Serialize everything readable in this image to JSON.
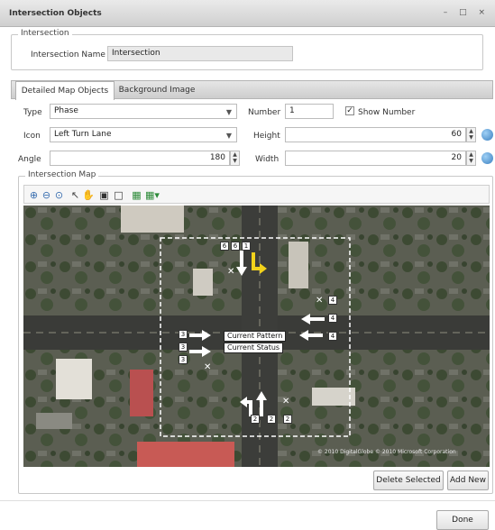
{
  "window": {
    "title": "Intersection Objects",
    "controls": "– □ ×"
  },
  "intersection_group": {
    "legend": "Intersection",
    "name_label": "Intersection Name",
    "name_value": "Intersection"
  },
  "tabs": [
    {
      "label": "Detailed Map Objects",
      "active": true
    },
    {
      "label": "Background Image",
      "active": false
    }
  ],
  "form": {
    "type_label": "Type",
    "type_value": "Phase",
    "number_label": "Number",
    "number_value": "1",
    "show_number_label": "Show Number",
    "show_number_checked": true,
    "icon_label": "Icon",
    "icon_value": "Left Turn Lane",
    "height_label": "Height",
    "height_value": "60",
    "angle_label": "Angle",
    "angle_value": "180",
    "width_label": "Width",
    "width_value": "20"
  },
  "map_group": {
    "legend": "Intersection Map",
    "toolbar_icons": [
      "zoom-in-icon",
      "zoom-out-icon",
      "zoom-fit-icon",
      "select-icon",
      "pan-icon",
      "text-box-icon",
      "rectangle-icon",
      "layer-icon",
      "layer-dropdown-icon"
    ]
  },
  "map": {
    "current_pattern": "Current Pattern",
    "current_status": "Current Status",
    "top_boxes": [
      "6",
      "6",
      "1"
    ],
    "bottom_boxes": [
      "2",
      "2",
      "2"
    ],
    "right_boxes": [
      "4",
      "4",
      "4"
    ],
    "left_boxes": [
      "3",
      "3",
      "3"
    ],
    "copyright": "© 2010 DigitalGlobe   © 2010 Microsoft Corporation"
  },
  "actions": {
    "delete_selected": "Delete Selected",
    "add_new": "Add New",
    "done": "Done"
  },
  "colors": {
    "accent_icon": "#3a7fc0",
    "selected_arrow": "#f2d21b"
  }
}
